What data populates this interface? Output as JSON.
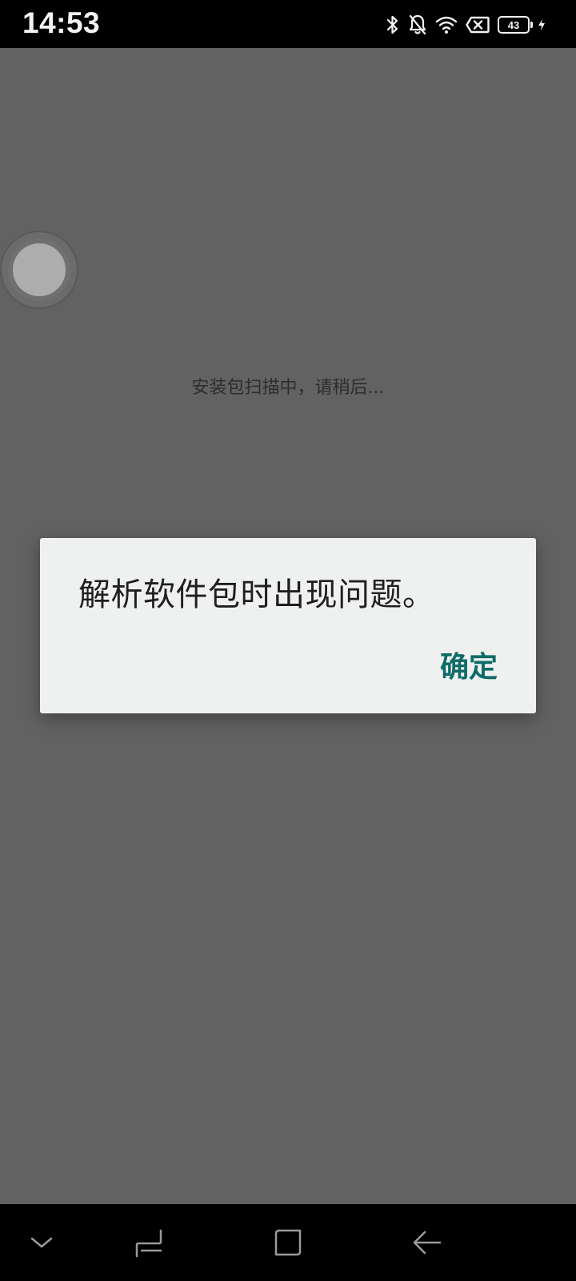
{
  "status_bar": {
    "time": "14:53",
    "battery_level": "43",
    "icons": [
      "bluetooth-icon",
      "notifications-off-icon",
      "wifi-icon",
      "no-sim-icon",
      "battery-icon",
      "charging-icon"
    ]
  },
  "scan_status": "安装包扫描中，请稍后...",
  "dialog": {
    "message": "解析软件包时出现问题。",
    "ok_label": "确定"
  },
  "nav_bar": {
    "buttons": [
      "hide-nav-chevron-icon",
      "recents-icon",
      "home-icon",
      "back-icon"
    ]
  },
  "colors": {
    "accent": "#0e6b68",
    "scrim": "#626262",
    "dialog_bg": "#eff0f0"
  }
}
